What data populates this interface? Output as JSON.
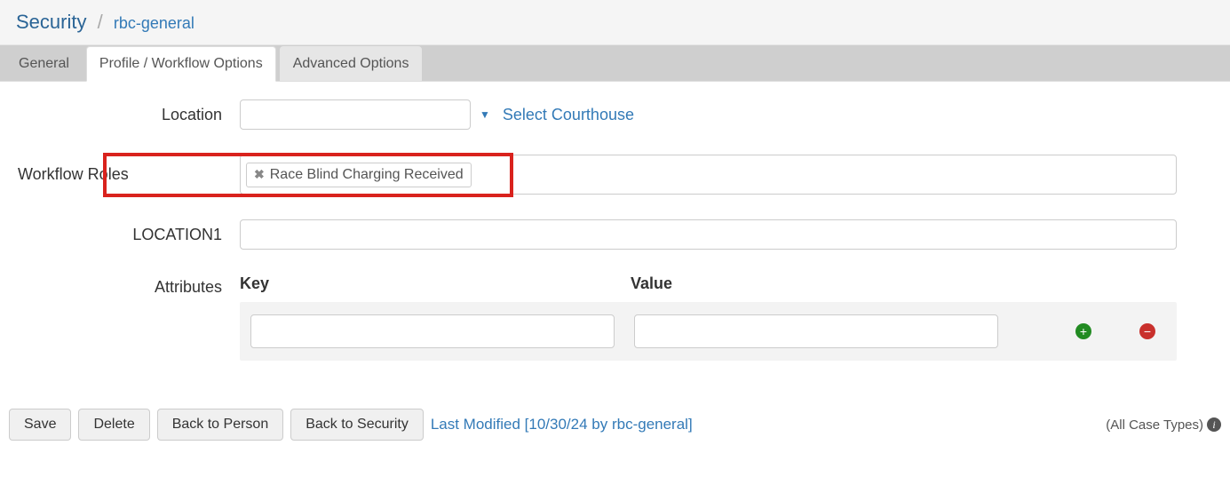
{
  "breadcrumb": {
    "root": "Security",
    "separator": "/",
    "current": "rbc-general"
  },
  "tabs": {
    "general": "General",
    "profile": "Profile / Workflow Options",
    "advanced": "Advanced Options"
  },
  "form": {
    "location_label": "Location",
    "location_value": "",
    "select_courthouse": "Select Courthouse",
    "workflow_roles_label": "Workflow Roles",
    "workflow_chip": "Race Blind Charging Received",
    "location1_label": "LOCATION1",
    "location1_value": "",
    "attributes_label": "Attributes",
    "key_header": "Key",
    "value_header": "Value",
    "key_value": "",
    "val_value": ""
  },
  "footer": {
    "save": "Save",
    "delete": "Delete",
    "back_person": "Back to Person",
    "back_security": "Back to Security",
    "last_modified": "Last Modified [10/30/24 by rbc-general]",
    "case_types": "(All Case Types)"
  }
}
